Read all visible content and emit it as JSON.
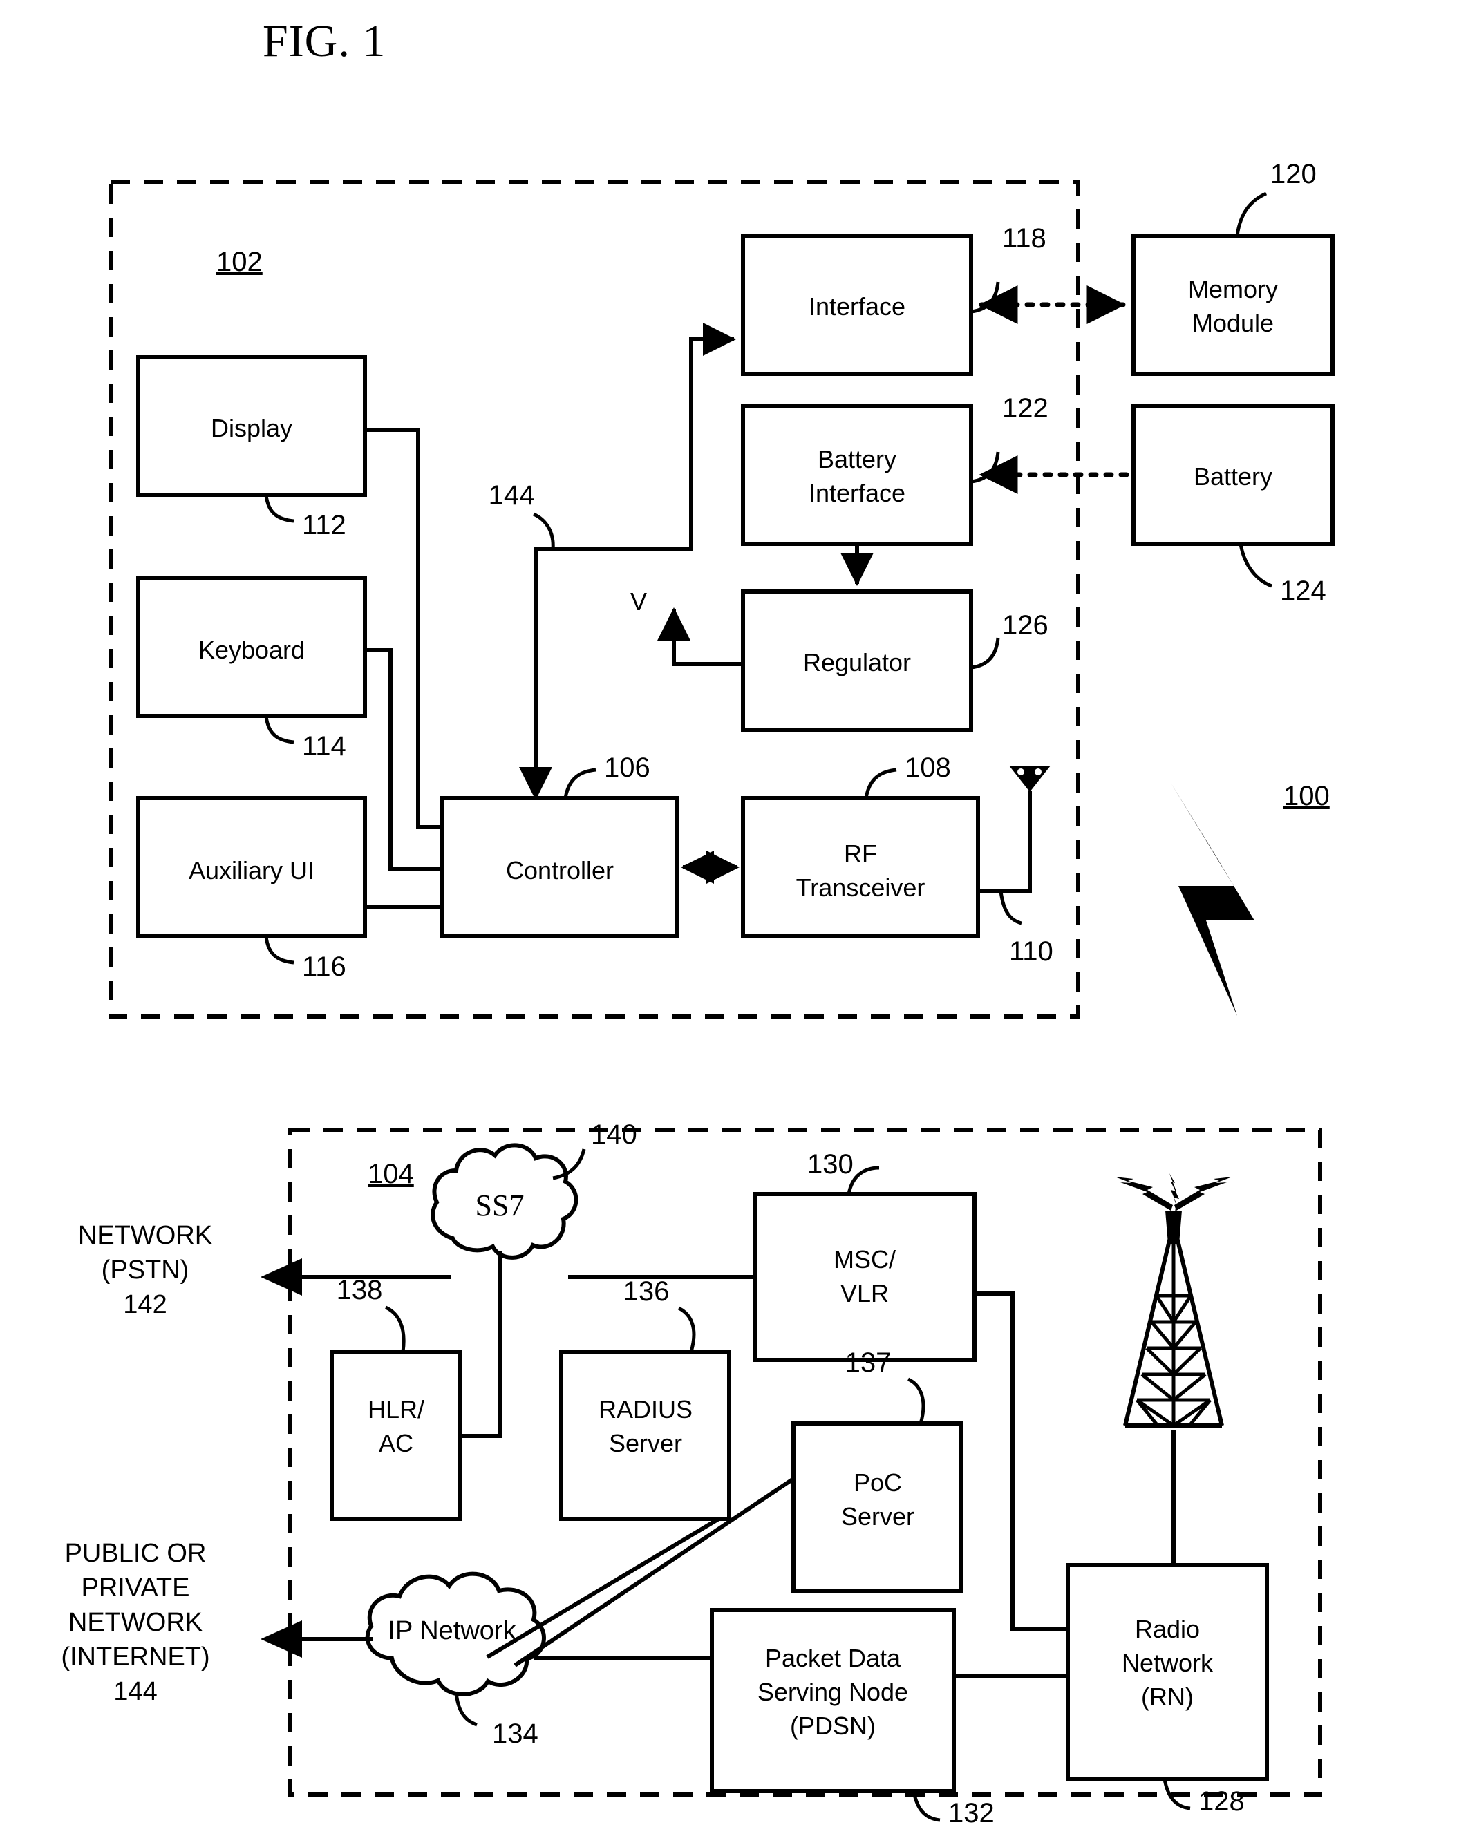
{
  "figure": {
    "title": "FIG. 1",
    "system_ref": "100"
  },
  "mobile_device": {
    "ref": "102",
    "blocks": [
      {
        "label": "Display",
        "ref": "112"
      },
      {
        "label": "Keyboard",
        "ref": "114"
      },
      {
        "label": "Auxiliary UI",
        "ref": "116"
      },
      {
        "label": "Controller",
        "ref": "106"
      },
      {
        "label": "RF Transceiver",
        "ref": "108"
      },
      {
        "label": "Interface",
        "ref": "118"
      },
      {
        "label": "Battery Interface",
        "ref": "122"
      },
      {
        "label": "Regulator",
        "ref": "126"
      }
    ],
    "antenna_ref": "110",
    "bus_ref": "144",
    "voltage_label": "V"
  },
  "external_components": [
    {
      "label": "Memory Module",
      "ref": "120"
    },
    {
      "label": "Battery",
      "ref": "124"
    }
  ],
  "network": {
    "ref": "104",
    "clouds": [
      {
        "label": "SS7",
        "ref": "140"
      },
      {
        "label": "IP Network",
        "ref": "134"
      }
    ],
    "blocks": [
      {
        "label": "MSC/ VLR",
        "line1": "MSC/",
        "line2": "VLR",
        "ref": "130"
      },
      {
        "label": "HLR/ AC",
        "line1": "HLR/",
        "line2": "AC",
        "ref": "138"
      },
      {
        "label": "RADIUS Server",
        "line1": "RADIUS",
        "line2": "Server",
        "ref": "136"
      },
      {
        "label": "PoC Server",
        "line1": "PoC",
        "line2": "Server",
        "ref": "137"
      },
      {
        "label": "Packet Data Serving Node (PDSN)",
        "line1": "Packet Data",
        "line2": "Serving Node",
        "line3": "(PDSN)",
        "ref": "132"
      },
      {
        "label": "Radio Network (RN)",
        "line1": "Radio",
        "line2": "Network",
        "line3": "(RN)",
        "ref": "128"
      }
    ],
    "tower": {
      "name": "radio-tower"
    }
  },
  "external_networks": [
    {
      "line1": "NETWORK",
      "line2": "(PSTN)",
      "ref": "142"
    },
    {
      "line1": "PUBLIC OR",
      "line2": "PRIVATE",
      "line3": "NETWORK",
      "line4": "(INTERNET)",
      "ref": "144"
    }
  ],
  "colors": {
    "ink": "#000000",
    "paper": "#ffffff"
  }
}
